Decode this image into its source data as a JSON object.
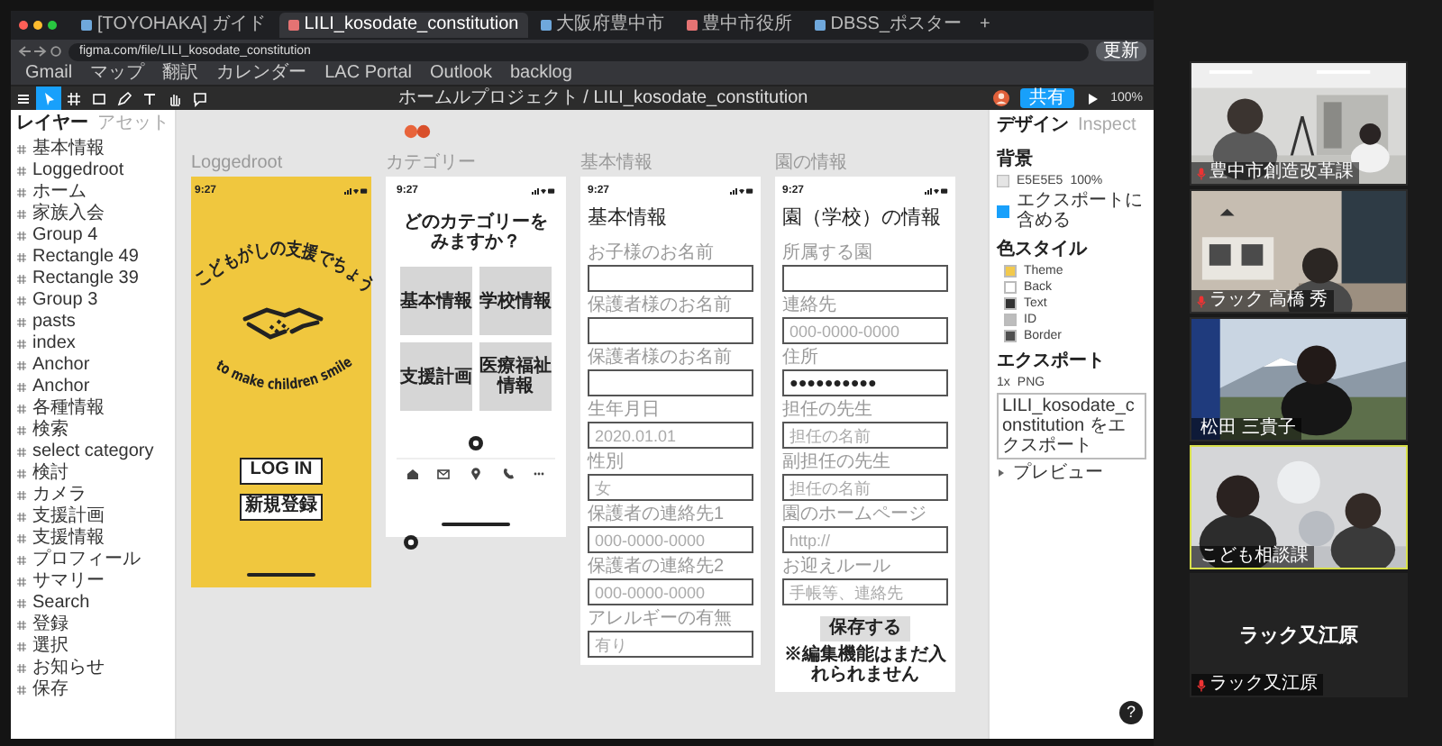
{
  "browser": {
    "tabs": [
      {
        "title": "[TOYOHAKA] ガイド",
        "selected": false
      },
      {
        "title": "LILI_kosodate_constitution",
        "selected": true
      },
      {
        "title": "大阪府豊中市",
        "selected": false
      },
      {
        "title": "豊中市役所",
        "selected": false
      },
      {
        "title": "DBSS_ポスター",
        "selected": false
      }
    ],
    "new_tab": "+",
    "address": "figma.com/file/LILI_kosodate_constitution",
    "bookmarks": [
      "Gmail",
      "マップ",
      "翻訳",
      "カレンダー",
      "LAC Portal",
      "Outlook",
      "backlog"
    ],
    "update_button": "更新"
  },
  "figma": {
    "tools": [
      {
        "kind": "menu",
        "selected": false
      },
      {
        "kind": "move",
        "selected": true
      },
      {
        "kind": "frame",
        "selected": false
      },
      {
        "kind": "shape",
        "selected": false
      },
      {
        "kind": "pen",
        "selected": false
      },
      {
        "kind": "text",
        "selected": false
      },
      {
        "kind": "hand",
        "selected": false
      },
      {
        "kind": "comment",
        "selected": false
      }
    ],
    "breadcrumb": "ホームルプロジェクト / LILI_kosodate_constitution",
    "share_button": "共有",
    "zoom": "100%",
    "layers_panel": {
      "tabs": [
        {
          "label": "レイヤー",
          "selected": true
        },
        {
          "label": "アセット",
          "selected": false
        }
      ],
      "items": [
        "基本情報",
        "Loggedroot",
        "ホーム",
        "家族入会",
        "Group 4",
        "Rectangle 49",
        "Rectangle 39",
        "Group 3",
        "pasts",
        "index",
        "Anchor",
        "Anchor",
        "各種情報",
        "検索",
        "select category",
        "検討",
        "カメラ",
        "支援計画",
        "支援情報",
        "プロフィール",
        "サマリー",
        "Search",
        "登録",
        "選択",
        "お知らせ",
        "保存"
      ]
    },
    "frames": [
      {
        "kind": "login",
        "label": "Loggedroot",
        "time": "9:27",
        "slogan_top": "こどもがしの支援でちょう",
        "slogan_bottom": "to make children smile",
        "buttons": [
          "LOG IN",
          "新規登録"
        ]
      },
      {
        "kind": "category",
        "label": "カテゴリー",
        "time": "9:27",
        "question": "どのカテゴリーをみますか？",
        "tiles": [
          "基本情報",
          "学校情報",
          "支援計画",
          "医療福祉情報"
        ],
        "nav": [
          {
            "kind": "home"
          },
          {
            "kind": "mail"
          },
          {
            "kind": "pin"
          },
          {
            "kind": "phone"
          },
          {
            "kind": "more"
          }
        ]
      },
      {
        "kind": "form",
        "label": "基本情報",
        "time": "9:27",
        "title": "基本情報",
        "fields": [
          {
            "label": "お子様のお名前"
          },
          {
            "label": "保護者様のお名前"
          },
          {
            "label": "保護者様のお名前"
          },
          {
            "label": "生年月日",
            "placeholder": "2020.01.01"
          },
          {
            "label": "性別",
            "placeholder": "女"
          },
          {
            "label": "保護者の連絡先1",
            "placeholder": "000-0000-0000"
          },
          {
            "label": "保護者の連絡先2",
            "placeholder": "000-0000-0000"
          },
          {
            "label": "アレルギーの有無",
            "placeholder": "有り"
          }
        ]
      },
      {
        "kind": "form",
        "label": "園の情報",
        "time": "9:27",
        "title": "園（学校）の情報",
        "fields": [
          {
            "label": "所属する園"
          },
          {
            "label": "連絡先",
            "placeholder": "000-0000-0000"
          },
          {
            "label": "住所",
            "value": "●●●●●●●●●●"
          },
          {
            "label": "担任の先生",
            "placeholder": "担任の名前"
          },
          {
            "label": "副担任の先生",
            "placeholder": "担任の名前"
          },
          {
            "label": "園のホームページ",
            "placeholder": "http://"
          },
          {
            "label": "お迎えルール",
            "placeholder": "手帳等、連絡先"
          }
        ],
        "save_button": "保存する",
        "note": "※編集機能はまだ入れられません"
      }
    ],
    "design_panel": {
      "tabs": [
        {
          "label": "デザイン",
          "selected": true
        },
        {
          "label": "Inspect",
          "selected": false
        }
      ],
      "background_heading": "背景",
      "background_hex": "E5E5E5",
      "background_opacity": "100%",
      "include_in_export": {
        "label": "エクスポートに含める",
        "checked": true
      },
      "color_styles_heading": "色スタイル",
      "color_styles": [
        {
          "name": "Theme",
          "color": "#f2c94c"
        },
        {
          "name": "Back",
          "color": "#ffffff"
        },
        {
          "name": "Text",
          "color": "#333333"
        },
        {
          "name": "ID",
          "color": "#bdbdbd"
        },
        {
          "name": "Border",
          "color": "#4f4f4f"
        }
      ],
      "export_heading": "エクスポート",
      "export_scale": "1x",
      "export_format": "PNG",
      "export_button": "LILI_kosodate_constitution をエクスポート",
      "preview": "プレビュー",
      "help": "?"
    }
  },
  "zoom_call": {
    "participants": [
      {
        "name": "豊中市創造改革課",
        "kind": "office",
        "muted": true,
        "speaking": false
      },
      {
        "name": "ラック 高橋 秀",
        "kind": "room",
        "muted": true,
        "speaking": false
      },
      {
        "name": "松田 三貴子",
        "kind": "mountain",
        "muted": false,
        "speaking": false
      },
      {
        "name": "こども相談課",
        "kind": "pair",
        "muted": false,
        "speaking": true
      },
      {
        "name": "ラック又江原",
        "kind": "name_only",
        "muted": true,
        "speaking": false,
        "display_name": "ラック又江原"
      }
    ]
  }
}
